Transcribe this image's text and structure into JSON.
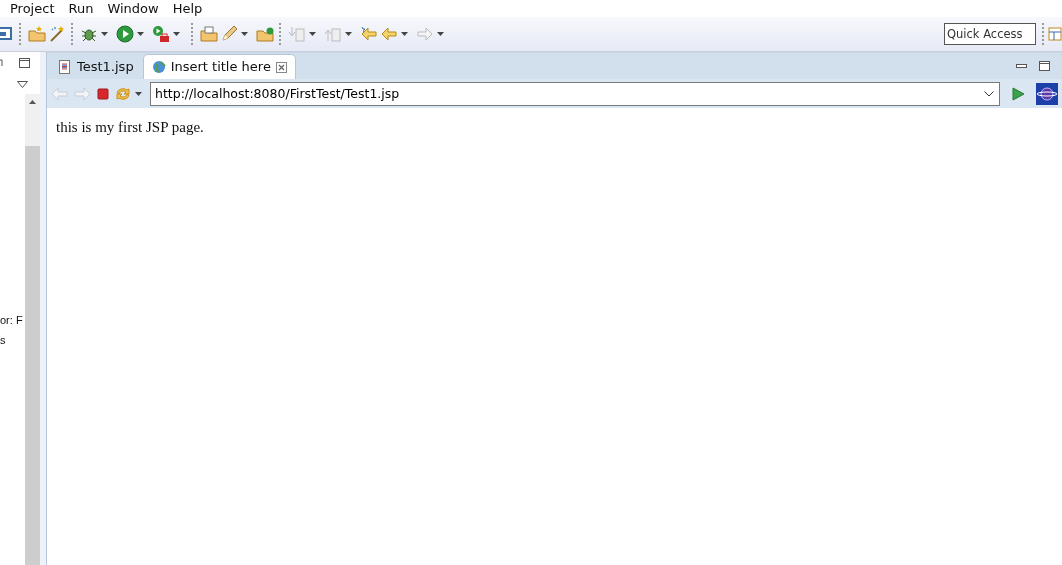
{
  "menu": [
    {
      "label": "Project"
    },
    {
      "label": "Run"
    },
    {
      "label": "Window"
    },
    {
      "label": "Help"
    }
  ],
  "quick_access": {
    "placeholder": "Quick Access"
  },
  "left_panel": {
    "texts": [
      "or: F",
      "s"
    ]
  },
  "tabs": [
    {
      "label": "Test1.jsp",
      "selected": false,
      "kind": "file"
    },
    {
      "label": "Insert title here",
      "selected": true,
      "kind": "web"
    }
  ],
  "browser": {
    "back_disabled": true,
    "forward_disabled": true,
    "url": "http://localhost:8080/FirstTest/Test1.jsp"
  },
  "page": {
    "text": "this is my first JSP page."
  }
}
